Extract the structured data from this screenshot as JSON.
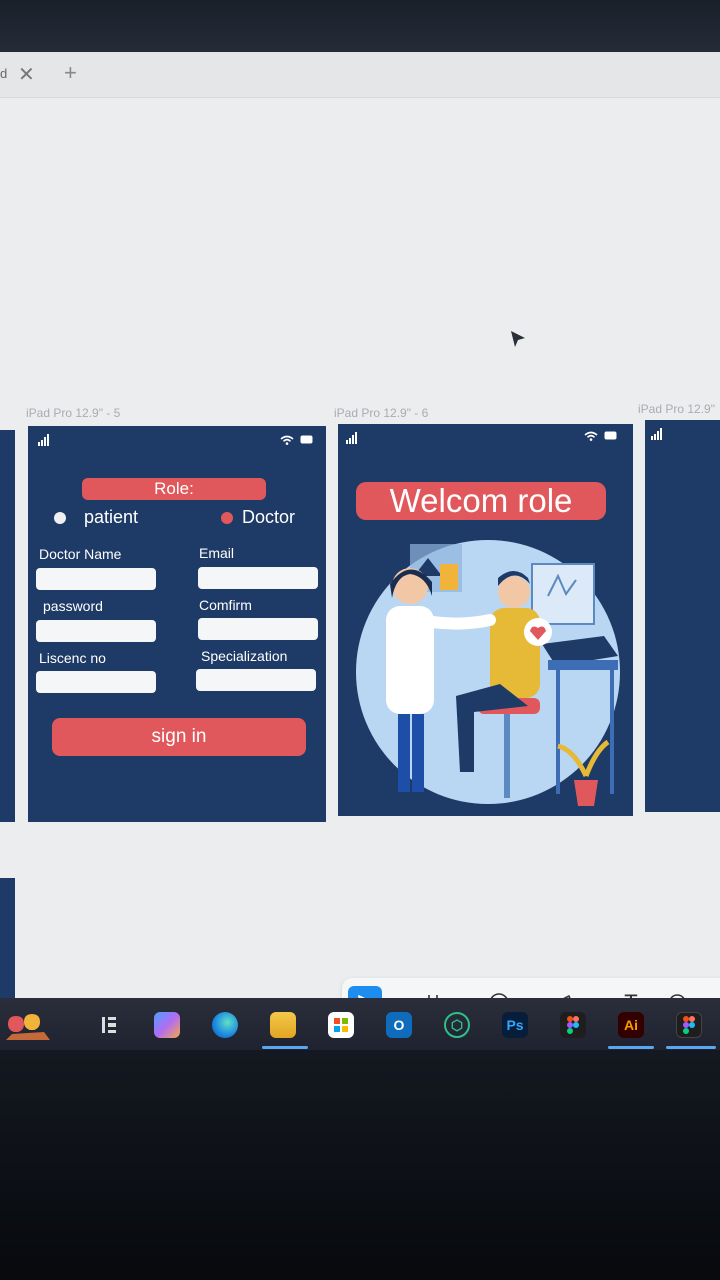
{
  "browser": {
    "tab_fragment": "d",
    "close_glyph": "✕",
    "add_glyph": "+"
  },
  "frames": {
    "form_label": "iPad Pro 12.9\" - 5",
    "welcome_label": "iPad Pro 12.9\" - 6",
    "right_label": "iPad Pro 12.9\""
  },
  "form": {
    "role_label": "Role:",
    "patient_label": "patient",
    "doctor_label": "Doctor",
    "doctor_name_label": "Doctor Name",
    "email_label": "Email",
    "password_label": "password",
    "confirm_label": "Comfirm",
    "license_label": "Liscenc no",
    "specialization_label": "Specialization",
    "sign_in_label": "sign in"
  },
  "welcome": {
    "title": "Welcom role"
  },
  "toolbar": {
    "tools": [
      "move-tool-icon",
      "frame-tool-icon",
      "ellipse-tool-icon",
      "pen-tool-icon",
      "text-tool-icon",
      "comment-tool-icon"
    ],
    "text_tool_glyph": "T"
  },
  "taskbar": {
    "photoshop_label": "Ps",
    "illustrator_label": "Ai",
    "outlook_label": "O"
  },
  "colors": {
    "frame_bg": "#1e3a66",
    "accent_red": "#e0585c",
    "toolbar_active": "#1d8ef0"
  }
}
